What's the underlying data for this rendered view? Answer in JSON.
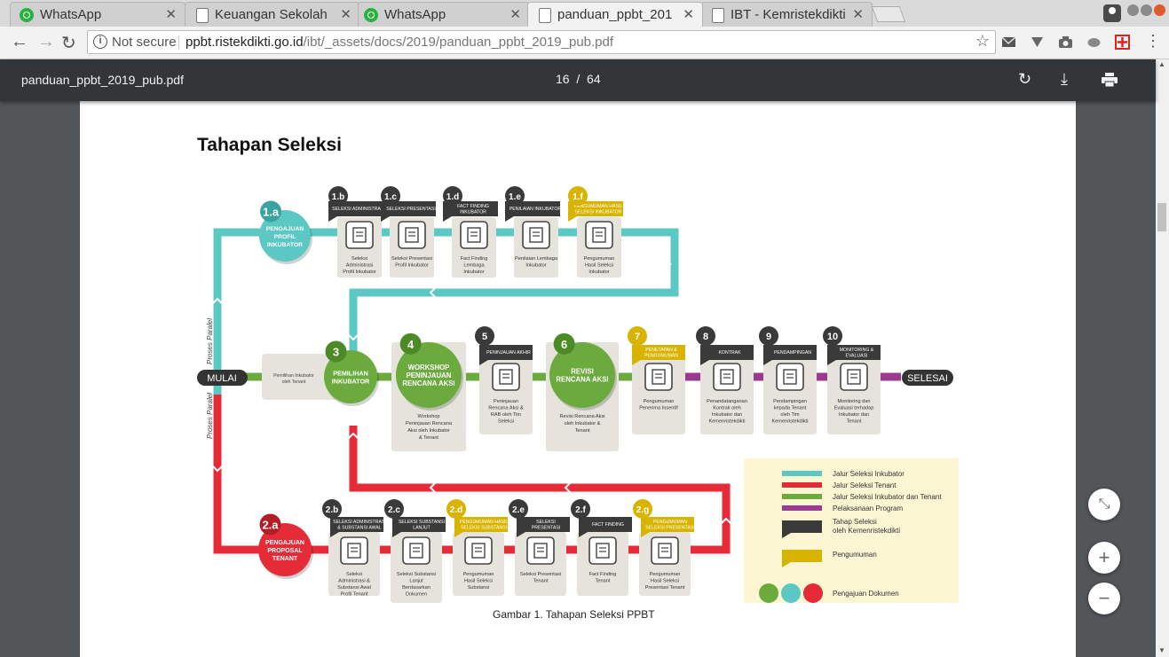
{
  "tabs": [
    {
      "title": "WhatsApp",
      "icon": "whatsapp-icon"
    },
    {
      "title": "Keuangan Sekolah",
      "icon": "document-icon"
    },
    {
      "title": "WhatsApp",
      "icon": "whatsapp-icon"
    },
    {
      "title": "panduan_ppbt_201",
      "icon": "document-icon"
    },
    {
      "title": "IBT - Kemristekdikti",
      "icon": "document-icon"
    }
  ],
  "address": {
    "security": "Not secure",
    "host": "ppbt.ristekdikti.go.id",
    "path": "/ibt/_assets/docs/2019/panduan_ppbt_2019_pub.pdf"
  },
  "pdf": {
    "filename": "panduan_ppbt_2019_pub.pdf",
    "page_current": "16",
    "page_sep": "/",
    "page_total": "64"
  },
  "doc": {
    "heading": "Tahapan Seleksi",
    "caption": "Gambar 1. Tahapan Seleksi PPBT",
    "mulai": "MULAI",
    "selesai": "SELESAI",
    "proses_paralel": "Proses Paralel",
    "pemilihan_note": "Pemilihan Inkubator oleh Tenant",
    "circles": {
      "c1a": {
        "num": "1.a",
        "lines": [
          "PENGAJUAN",
          "PROFIL",
          "INKUBATOR"
        ]
      },
      "c3": {
        "num": "3",
        "lines": [
          "PEMILIHAN",
          "INKUBATOR"
        ]
      },
      "c4": {
        "num": "4",
        "lines": [
          "WORKSHOP",
          "PENINJAUAN",
          "RENCANA AKSI"
        ]
      },
      "c6": {
        "num": "6",
        "lines": [
          "REVISI",
          "RENCANA AKSI"
        ]
      },
      "c2a": {
        "num": "2.a",
        "lines": [
          "PENGAJUAN",
          "PROPOSAL",
          "TENANT"
        ]
      }
    },
    "top_steps": [
      {
        "num": "1.b",
        "label": [
          "SELEKSI ADMINISTRASI"
        ],
        "desc": [
          "Seleksi",
          "Administrasi",
          "Profil Inkubator"
        ]
      },
      {
        "num": "1.c",
        "label": [
          "SELEKSI PRESENTASI"
        ],
        "desc": [
          "Seleksi Presentasi",
          "Profil Inkubator"
        ]
      },
      {
        "num": "1.d",
        "label": [
          "FACT FINDING",
          "INKUBATOR"
        ],
        "desc": [
          "Fact Finding",
          "Lembaga",
          "Inkubator"
        ]
      },
      {
        "num": "1.e",
        "label": [
          "PENILAIAN INKUBATOR"
        ],
        "desc": [
          "Penilaian Lembaga",
          "Inkubator"
        ]
      },
      {
        "num": "1.f",
        "label": [
          "PENGUMUMAN HASIL",
          "SELEKSI INKUBATOR"
        ],
        "desc": [
          "Pengumuman",
          "Hasil Seleksi",
          "Inkubator"
        ]
      }
    ],
    "mid_steps": [
      {
        "num": "5",
        "label": [
          "PENINJAUAN AKHIR"
        ],
        "desc": [
          "Peninjauan",
          "Rencana Aksi &",
          "RAB oleh Tim",
          "Seleksi"
        ]
      },
      {
        "num": "7",
        "label": [
          "PENETAPAN &",
          "PENGUMUMAN"
        ],
        "desc": [
          "Pengumuman",
          "Penerima Insentif"
        ]
      },
      {
        "num": "8",
        "label": [
          "KONTRAK"
        ],
        "desc": [
          "Penandatanganan",
          "Kontrak oleh",
          "Inkubator dan",
          "Kemenristekdikti"
        ]
      },
      {
        "num": "9",
        "label": [
          "PENDAMPINGAN"
        ],
        "desc": [
          "Pendampingan",
          "kepada Tenant",
          "oleh Tim",
          "Kemenristekdikti"
        ]
      },
      {
        "num": "10",
        "label": [
          "MONITORING &",
          "EVALUASI"
        ],
        "desc": [
          "Monitoring dan",
          "Evaluasi terhadap",
          "Inkubator dan",
          "Tenant"
        ]
      }
    ],
    "box4_desc": [
      "Workshop",
      "Peninjauan Rencana",
      "Aksi oleh Inkubator",
      "& Tenant"
    ],
    "box6_desc": [
      "Revisi Rencana Aksi",
      "oleh Inkubator &",
      "Tenant"
    ],
    "bottom_steps": [
      {
        "num": "2.b",
        "label": [
          "SELEKSI ADMINISTRASI",
          "& SUBSTANSI AWAL"
        ],
        "desc": [
          "Seleksi",
          "Administrasi &",
          "Substansi Awal",
          "Profil Tenant"
        ]
      },
      {
        "num": "2.c",
        "label": [
          "SELEKSI SUBSTANSI",
          "LANJUT"
        ],
        "desc": [
          "Seleksi Substansi",
          "Lanjut",
          "Berdasarkan",
          "Dokumen"
        ]
      },
      {
        "num": "2.d",
        "label": [
          "PENGUMUMAN HASIL",
          "SELEKSI SUBSTANSI"
        ],
        "desc": [
          "Pengumuman",
          "Hasil Seleksi",
          "Substansi"
        ]
      },
      {
        "num": "2.e",
        "label": [
          "SELEKSI",
          "PRESENTASI"
        ],
        "desc": [
          "Seleksi Presentasi",
          "Tenant"
        ]
      },
      {
        "num": "2.f",
        "label": [
          "FACT FINDING"
        ],
        "desc": [
          "Fact Finding",
          "Tenant"
        ]
      },
      {
        "num": "2.g",
        "label": [
          "PENGUMUMAN",
          "SELEKSI PRESENTASI"
        ],
        "desc": [
          "Pengumuman",
          "Hasil Seleksi",
          "Presentasi Tenant"
        ]
      }
    ],
    "legend": [
      {
        "kind": "line",
        "color": "#5cc8c4",
        "text": [
          "Jalur Seleksi Inkubator"
        ]
      },
      {
        "kind": "line",
        "color": "#e42b37",
        "text": [
          "Jalur Seleksi Tenant"
        ]
      },
      {
        "kind": "line",
        "color": "#6bab3e",
        "text": [
          "Jalur Seleksi Inkubator dan Tenant"
        ]
      },
      {
        "kind": "line",
        "color": "#9b3b90",
        "text": [
          "Pelaksanaan Program"
        ]
      },
      {
        "kind": "flag",
        "color": "#3a3a3a",
        "text": [
          "Tahap Seleksi",
          "oleh Kemenristekdikti"
        ]
      },
      {
        "kind": "flag",
        "color": "#d8b400",
        "text": [
          "Pengumuman"
        ]
      },
      {
        "kind": "dots",
        "color": "",
        "text": [
          "Pengajuan Dokumen"
        ]
      }
    ],
    "colors": {
      "teal": "#5cc8c4",
      "red": "#e42b37",
      "green": "#6bab3e",
      "purple": "#9b3b90",
      "yellow": "#d8b400",
      "dark": "#3a3a3a",
      "box": "#e6e3dc",
      "legend_bg": "#fdf6d3"
    }
  }
}
